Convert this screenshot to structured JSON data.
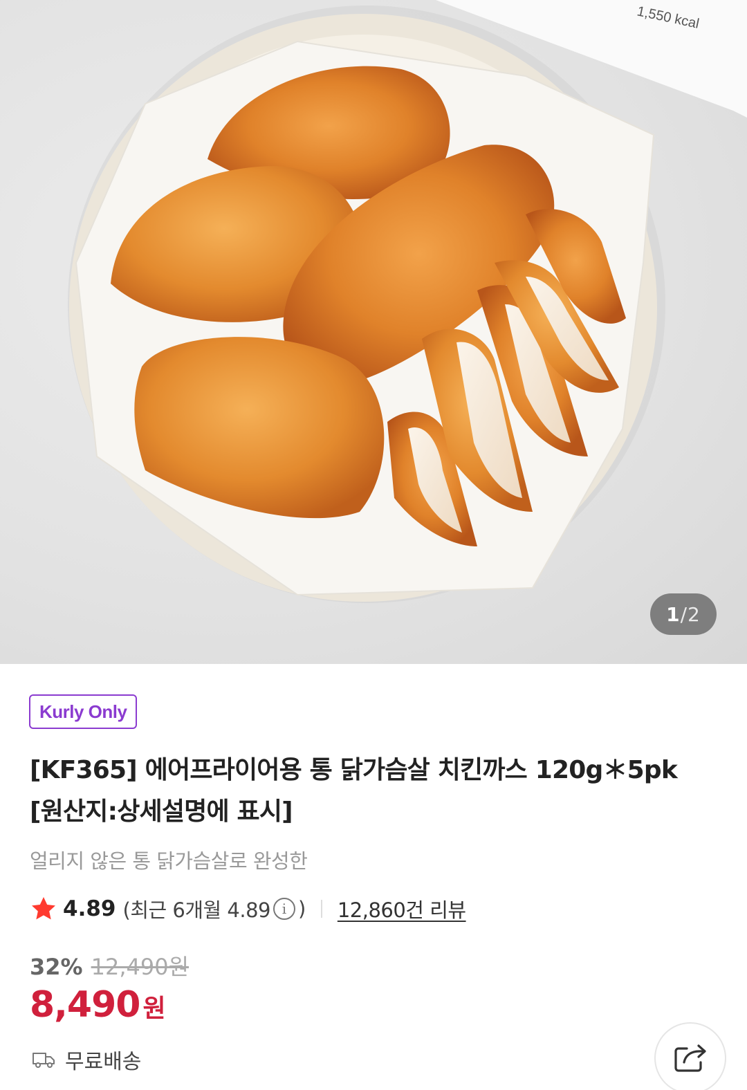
{
  "gallery": {
    "current_page": "1",
    "separator": "/",
    "total_pages": "2",
    "package_label_text": "1,550 kcal"
  },
  "product": {
    "badge": "Kurly Only",
    "title": "[KF365] 에어프라이어용 통 닭가슴살 치킨까스 120g＊5pk [원산지:상세설명에 표시]",
    "subtitle": "얼리지 않은 통 닭가슴살로 완성한"
  },
  "rating": {
    "score": "4.89",
    "recent_prefix": "(최근 6개월 4.89",
    "recent_suffix": ")",
    "info_glyph": "i",
    "review_count": "12,860건 리뷰"
  },
  "price": {
    "discount_rate": "32%",
    "original": "12,490원",
    "sale_value": "8,490",
    "sale_unit": "원"
  },
  "shipping": {
    "label": "무료배송"
  },
  "colors": {
    "brand_purple": "#8b3bd0",
    "price_red": "#d0203c",
    "star_red": "#ff3a2f"
  },
  "icons": {
    "star": "star-icon",
    "info": "info-icon",
    "truck": "truck-icon",
    "share": "share-icon"
  }
}
